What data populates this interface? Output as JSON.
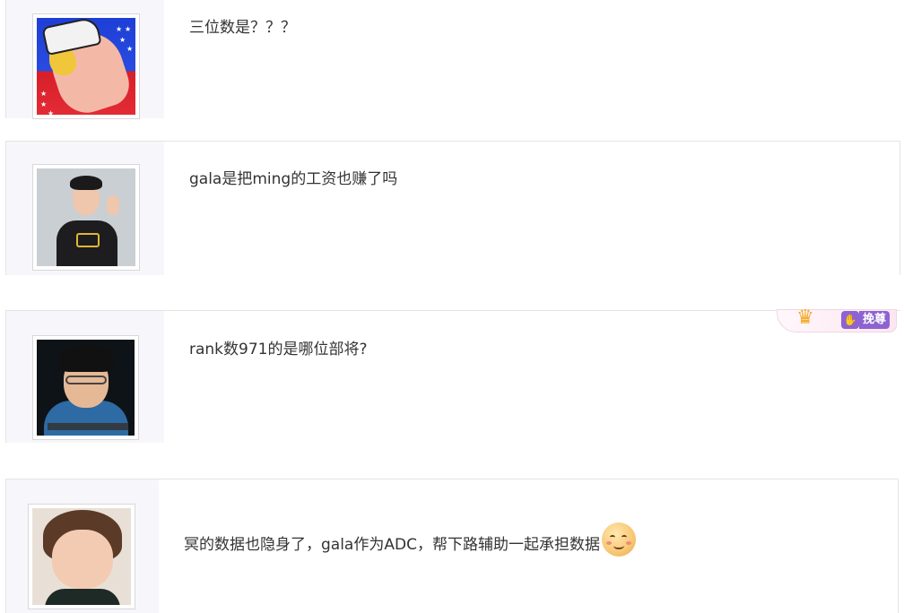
{
  "posts": [
    {
      "avatar": "avatar-anime-character",
      "text": "三位数是？？？"
    },
    {
      "avatar": "avatar-player-waving",
      "text": "gala是把ming的工资也赚了吗"
    },
    {
      "avatar": "avatar-player-glasses",
      "text": "rank数971的是哪位部将?"
    },
    {
      "avatar": "avatar-child",
      "text": "冥的数据也隐身了，gala作为ADC，帮下路辅助一起承担数据",
      "emoji": "smiling-face-emoji"
    }
  ],
  "badge": {
    "icon": "crown-icon",
    "vip_icon": "paw-icon",
    "label": "挽尊"
  },
  "colors": {
    "sidebar_bg": "#f7f7fb",
    "border": "#e4e4e4",
    "text": "#333333",
    "badge_purple": "#8d63d1"
  }
}
